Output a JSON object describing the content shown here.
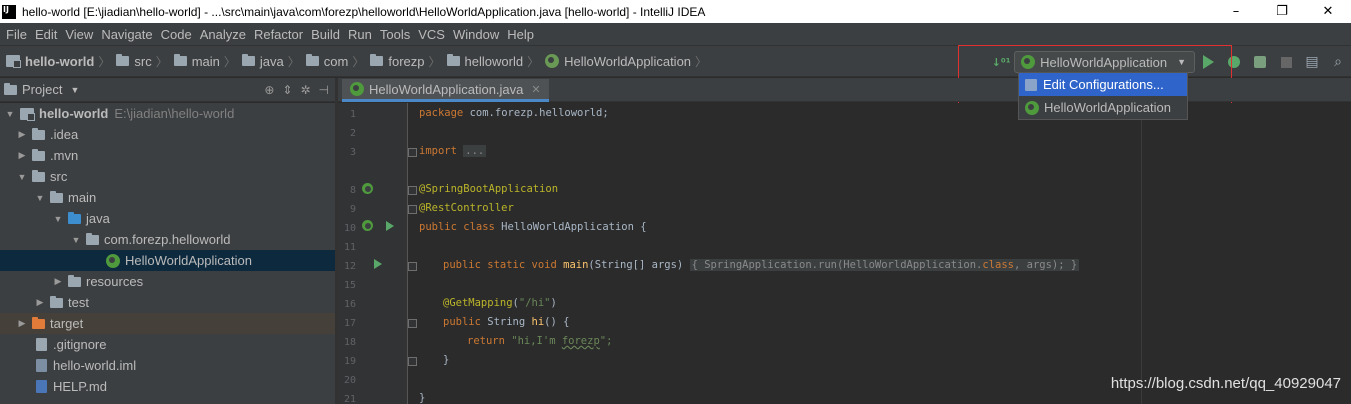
{
  "titlebar": {
    "title": "hello-world [E:\\jiadian\\hello-world] - ...\\src\\main\\java\\com\\forezp\\helloworld\\HelloWorldApplication.java [hello-world] - IntelliJ IDEA",
    "minimize": "–",
    "maximize": "❐",
    "close": "✕"
  },
  "menu": [
    "File",
    "Edit",
    "View",
    "Navigate",
    "Code",
    "Analyze",
    "Refactor",
    "Build",
    "Run",
    "Tools",
    "VCS",
    "Window",
    "Help"
  ],
  "breadcrumbs": [
    "hello-world",
    "src",
    "main",
    "java",
    "com",
    "forezp",
    "helloworld",
    "HelloWorldApplication"
  ],
  "run_config": {
    "selected": "HelloWorldApplication",
    "dropdown": [
      "Edit Configurations...",
      "HelloWorldApplication"
    ]
  },
  "project_panel": {
    "title": "Project",
    "tree": [
      {
        "label": "hello-world",
        "sub": "E:\\jiadian\\hello-world"
      },
      {
        "label": ".idea"
      },
      {
        "label": ".mvn"
      },
      {
        "label": "src"
      },
      {
        "label": "main"
      },
      {
        "label": "java"
      },
      {
        "label": "com.forezp.helloworld"
      },
      {
        "label": "HelloWorldApplication"
      },
      {
        "label": "resources"
      },
      {
        "label": "test"
      },
      {
        "label": "target"
      },
      {
        "label": ".gitignore"
      },
      {
        "label": "hello-world.iml"
      },
      {
        "label": "HELP.md"
      }
    ]
  },
  "editor": {
    "tab": "HelloWorldApplication.java",
    "line_numbers": [
      "1",
      "2",
      "3",
      "8",
      "9",
      "10",
      "11",
      "12",
      "15",
      "16",
      "17",
      "18",
      "19",
      "20",
      "21"
    ],
    "code": {
      "l1_kw": "package",
      "l1_rest": " com.forezp.helloworld;",
      "l3_kw": "import",
      "l3_fold": "...",
      "l8": "@SpringBootApplication",
      "l9": "@RestController",
      "l10_kw": "public class",
      "l10_rest": " HelloWorldApplication {",
      "l12_kw": "public static void",
      "l12_fn": "main",
      "l12_args": "(String[] args)",
      "l12_fold": "{ SpringApplication.run(HelloWorldApplication.",
      "l12_kw2": "class",
      "l12_tail": ", args); }",
      "l16_ann": "@GetMapping",
      "l16_open": "(",
      "l16_str": "\"/hi\"",
      "l16_close": ")",
      "l17_kw": "public",
      "l17_type": " String ",
      "l17_fn": "hi",
      "l17_rest": "() {",
      "l18_kw": "return",
      "l18_str_a": "\"hi,I'm ",
      "l18_str_b": "forezp",
      "l18_str_c": "\";",
      "l19": "}",
      "l21": "}"
    }
  },
  "watermark": "https://blog.csdn.net/qq_40929047",
  "colors": {
    "accent": "#2f65ca",
    "highlight_box": "#e03030",
    "run_green": "#59a869"
  }
}
